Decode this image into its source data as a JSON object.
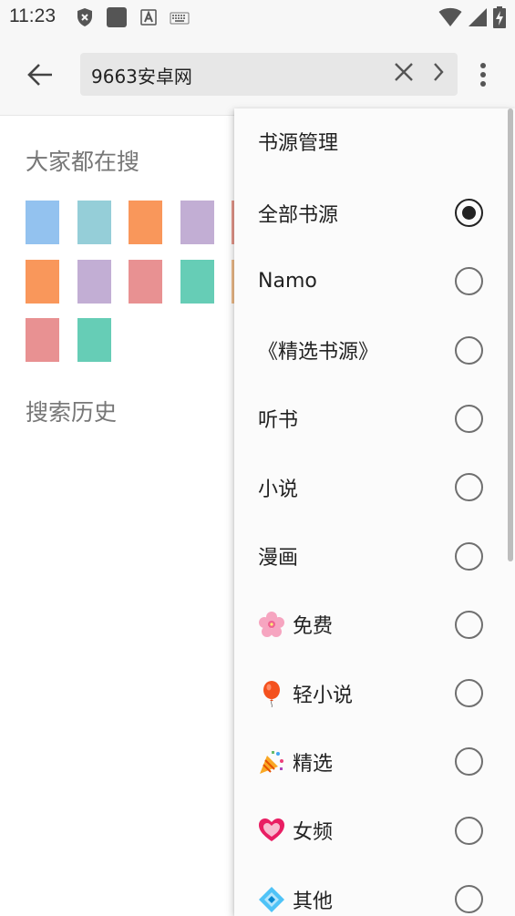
{
  "status_bar": {
    "time": "11:23",
    "icons": [
      "shield-icon",
      "square-app-icon",
      "font-a-icon",
      "keyboard-icon",
      "wifi-icon",
      "signal-icon",
      "battery-charging-icon"
    ]
  },
  "app_bar": {
    "back_icon": "arrow-left-icon",
    "search_value": "9663安卓网",
    "clear_icon": "close-icon",
    "go_icon": "chevron-right-icon",
    "more_icon": "more-vert-icon"
  },
  "content": {
    "popular_title": "大家都在搜",
    "history_title": "搜索历史",
    "popular_swatch_colors": [
      "#93C2EF",
      "#95CED8",
      "#F9975B",
      "#C2AED4",
      "#E89A8E",
      "#F9975B",
      "#C2AED4",
      "#E89192",
      "#66CDB6",
      "#F1BE8C",
      "#E89192",
      "#66CDB6"
    ]
  },
  "menu": {
    "header": "书源管理",
    "items": [
      {
        "label": "全部书源",
        "icon": "",
        "checked": true
      },
      {
        "label": "Namo",
        "icon": "",
        "checked": false
      },
      {
        "label": "《精选书源》",
        "icon": "",
        "checked": false
      },
      {
        "label": "听书",
        "icon": "",
        "checked": false
      },
      {
        "label": "小说",
        "icon": "",
        "checked": false
      },
      {
        "label": "漫画",
        "icon": "",
        "checked": false
      },
      {
        "label": "免费",
        "icon": "cherry-blossom-icon",
        "checked": false
      },
      {
        "label": "轻小说",
        "icon": "balloon-icon",
        "checked": false
      },
      {
        "label": "精选",
        "icon": "party-popper-icon",
        "checked": false
      },
      {
        "label": "女频",
        "icon": "sparkling-heart-icon",
        "checked": false
      },
      {
        "label": "其他",
        "icon": "diamond-dot-icon",
        "checked": false
      }
    ]
  }
}
